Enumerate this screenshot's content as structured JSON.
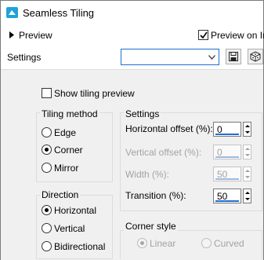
{
  "window": {
    "title": "Seamless Tiling"
  },
  "preview_row": {
    "preview_label": "Preview",
    "preview_on_image_label": "Preview on Im",
    "preview_on_image_checked": true
  },
  "settings_row": {
    "label": "Settings",
    "preset_value": ""
  },
  "show_tiling_preview": {
    "label": "Show tiling preview",
    "checked": false
  },
  "tiling_method": {
    "title": "Tiling method",
    "options": [
      "Edge",
      "Corner",
      "Mirror"
    ],
    "selected": "Corner"
  },
  "direction": {
    "title": "Direction",
    "options": [
      "Horizontal",
      "Vertical",
      "Bidirectional"
    ],
    "selected": "Horizontal"
  },
  "settings_group": {
    "title": "Settings",
    "horizontal_offset": {
      "label": "Horizontal offset (%):",
      "value": "0",
      "enabled": true
    },
    "vertical_offset": {
      "label": "Vertical offset (%):",
      "value": "0",
      "enabled": false
    },
    "width": {
      "label": "Width (%):",
      "value": "50",
      "enabled": false
    },
    "transition": {
      "label": "Transition (%):",
      "value": "50",
      "enabled": true
    }
  },
  "corner_style": {
    "title": "Corner style",
    "options": [
      "Linear",
      "Curved"
    ],
    "selected": "Linear",
    "enabled": false
  },
  "colors": {
    "accent": "#1e6fd0",
    "title_icon": "#1fa3d8",
    "panel": "#f0f0f0"
  }
}
